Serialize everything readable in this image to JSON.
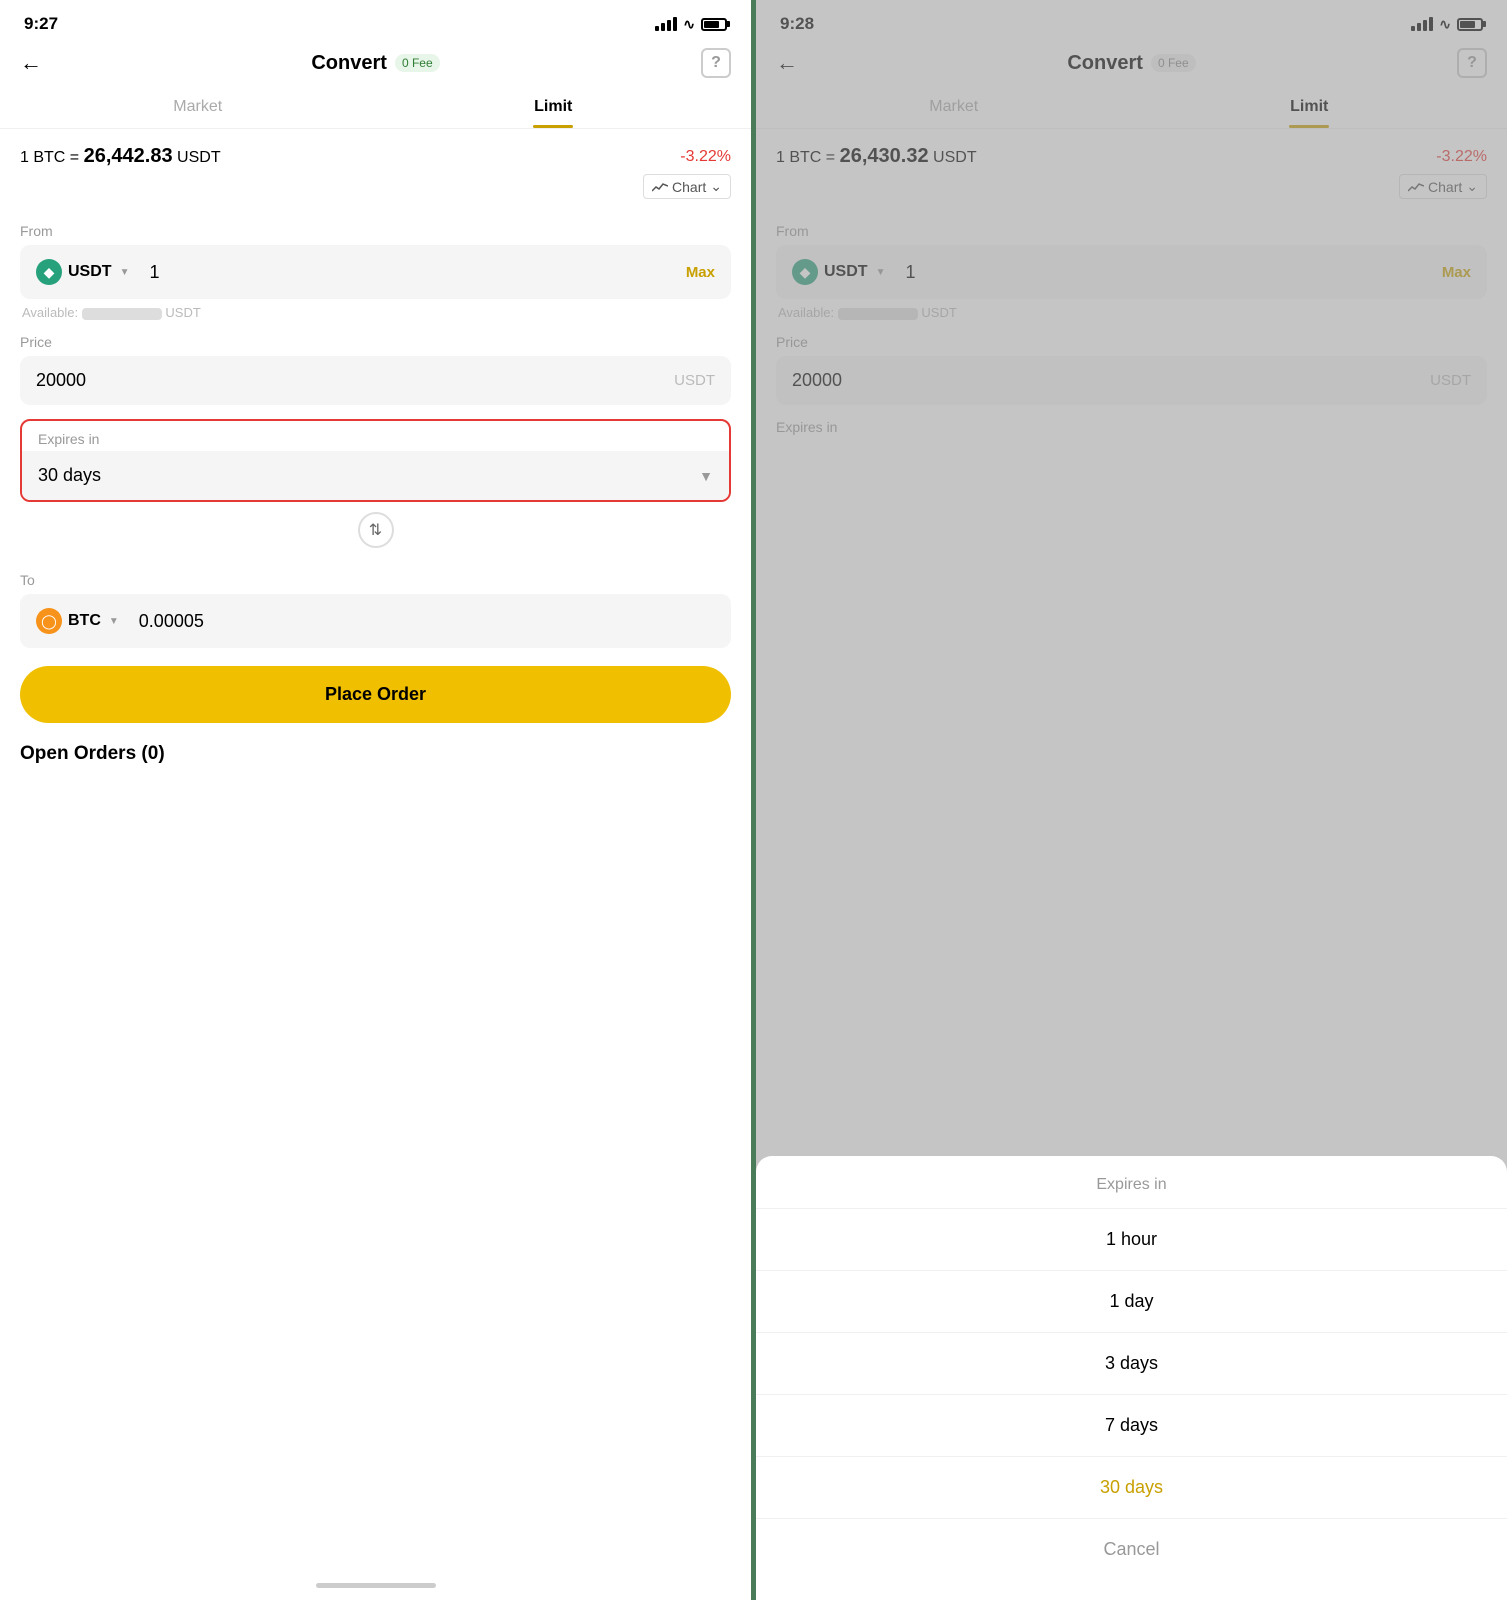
{
  "left": {
    "status": {
      "time": "9:27"
    },
    "header": {
      "title": "Convert",
      "fee": "0 Fee",
      "help": "?"
    },
    "tabs": [
      {
        "label": "Market",
        "active": false
      },
      {
        "label": "Limit",
        "active": true
      }
    ],
    "price": {
      "prefix": "1 BTC =",
      "value": "26,442.83",
      "unit": "USDT",
      "change": "-3.22%"
    },
    "chart_btn": "Chart",
    "from": {
      "label": "From",
      "currency": "USDT",
      "value": "1",
      "max": "Max",
      "available_label": "Available:",
      "available_unit": "USDT"
    },
    "price_field": {
      "label": "Price",
      "value": "20000",
      "unit": "USDT"
    },
    "expires": {
      "label": "Expires in",
      "value": "30 days"
    },
    "to": {
      "label": "To",
      "currency": "BTC",
      "value": "0.00005"
    },
    "place_order": "Place Order",
    "open_orders": "Open Orders (0)"
  },
  "right": {
    "status": {
      "time": "9:28"
    },
    "header": {
      "title": "Convert",
      "fee": "0 Fee",
      "help": "?"
    },
    "tabs": [
      {
        "label": "Market",
        "active": false
      },
      {
        "label": "Limit",
        "active": true
      }
    ],
    "price": {
      "prefix": "1 BTC =",
      "value": "26,430.32",
      "unit": "USDT",
      "change": "-3.22%"
    },
    "chart_btn": "Chart",
    "from": {
      "label": "From",
      "currency": "USDT",
      "value": "1",
      "max": "Max",
      "available_label": "Available:",
      "available_unit": "USDT"
    },
    "price_field": {
      "label": "Price",
      "value": "20000",
      "unit": "USDT"
    },
    "expires": {
      "label": "Expires in"
    },
    "picker": {
      "header": "Expires in",
      "options": [
        {
          "label": "1 hour",
          "selected": false
        },
        {
          "label": "1 day",
          "selected": false
        },
        {
          "label": "3 days",
          "selected": false
        },
        {
          "label": "7 days",
          "selected": false
        },
        {
          "label": "30 days",
          "selected": true
        },
        {
          "label": "Cancel",
          "cancel": true
        }
      ]
    }
  }
}
